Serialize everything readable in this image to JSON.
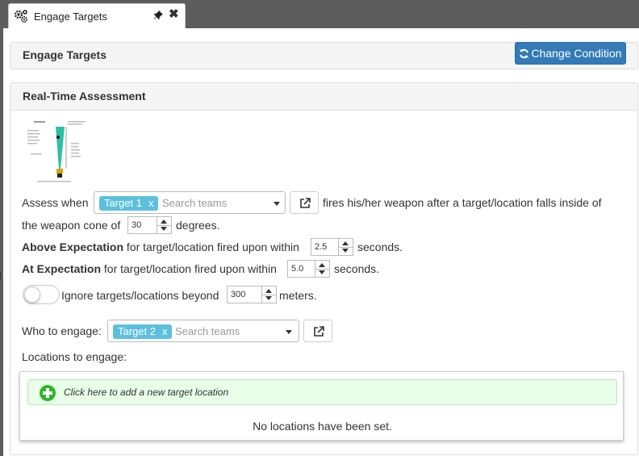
{
  "tab": {
    "title": "Engage Targets",
    "close": "✖",
    "icons": [
      "gears-icon",
      "pin-icon",
      "close-icon"
    ]
  },
  "header_panel": {
    "title": "Engage Targets",
    "change_condition_label": "Change Condition",
    "button_icon": "refresh-icon",
    "accent": "#337ab7"
  },
  "assessment": {
    "title": "Real-Time Assessment",
    "assess_when_label": "Assess when",
    "who_selected": "Target 1",
    "chip_remove": "x",
    "search_placeholder": "Search teams",
    "fires_text": "fires his/her weapon after a target/location falls inside of",
    "cone_prefix": "the weapon cone of",
    "cone_value": "30",
    "cone_suffix": "degrees.",
    "above_label": "Above Expectation",
    "above_text": "for target/location fired upon within",
    "above_value": "2.5",
    "above_suffix": "seconds.",
    "at_label": "At Expectation",
    "at_text": "for target/location fired upon within",
    "at_value": "5.0",
    "at_suffix": "seconds.",
    "ignore_toggle_on": false,
    "ignore_text": "Ignore targets/locations beyond",
    "ignore_value": "300",
    "ignore_suffix": "meters.",
    "who_to_engage_label": "Who to engage:",
    "engage_selected": "Target 2",
    "engage_placeholder": "Search teams",
    "locations_label": "Locations to engage:",
    "add_location_text": "Click here to add a new target location",
    "empty_text": "No locations have been set.",
    "chip_color": "#5bc0de",
    "add_color": "#2db52d"
  }
}
